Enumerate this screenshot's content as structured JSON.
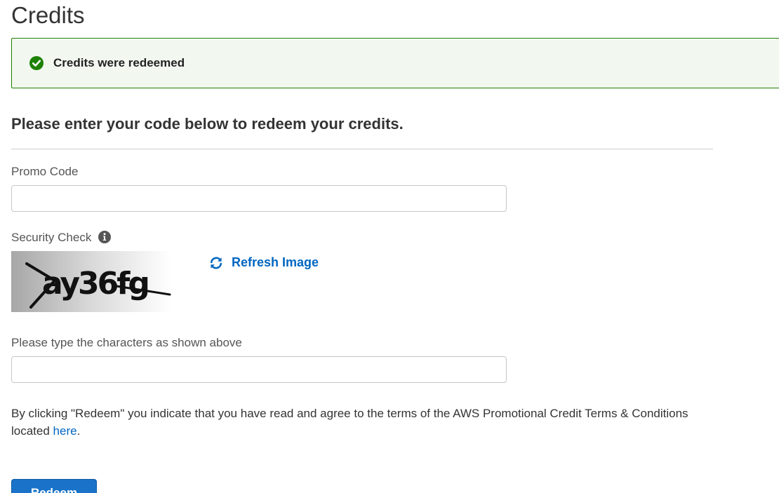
{
  "page": {
    "title": "Credits"
  },
  "alert": {
    "message": "Credits were redeemed",
    "icon": "check-circle-icon",
    "color": "#1d8102"
  },
  "form": {
    "heading": "Please enter your code below to redeem your credits.",
    "promo_code": {
      "label": "Promo Code",
      "value": "",
      "placeholder": ""
    },
    "security_check": {
      "label": "Security Check",
      "info_icon": "info-circle-icon",
      "captcha_text": "ay36fg",
      "refresh_label": "Refresh Image",
      "refresh_icon": "refresh-icon"
    },
    "captcha_input": {
      "label": "Please type the characters as shown above",
      "value": "",
      "placeholder": ""
    },
    "terms": {
      "prefix": "By clicking \"Redeem\" you indicate that you have read and agree to the terms of the AWS Promotional Credit Terms & Conditions located ",
      "link_text": "here",
      "suffix": "."
    },
    "submit_label": "Redeem"
  },
  "colors": {
    "link": "#0066c0",
    "button": "#1a73c8",
    "success": "#1d8102"
  }
}
